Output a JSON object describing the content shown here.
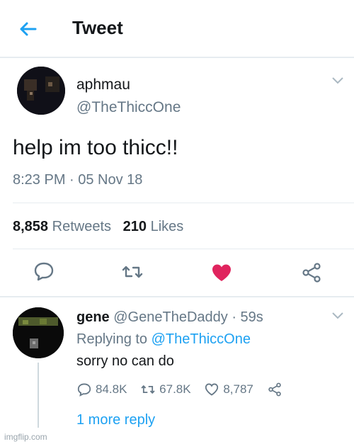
{
  "header": {
    "title": "Tweet"
  },
  "tweet": {
    "name": "aphmau",
    "handle": "@TheThiccOne",
    "text": "help im too thicc!!",
    "timestamp": "8:23 PM · 05 Nov 18",
    "retweets_count": "8,858",
    "retweets_label": "Retweets",
    "likes_count": "210",
    "likes_label": "Likes"
  },
  "reply": {
    "name": "gene",
    "handle": "@GeneTheDaddy",
    "time": "· 59s",
    "replying_prefix": "Replying to",
    "replying_to": "@TheThiccOne",
    "text": "sorry no can do",
    "reply_count": "84.8K",
    "retweet_count": "67.8K",
    "like_count": "8,787",
    "more_replies": "1 more reply"
  },
  "watermark": "imgflip.com",
  "colors": {
    "accent": "#1da1f2",
    "like": "#e0245e",
    "secondary_text": "#657786",
    "primary_text": "#14171a"
  },
  "icons": [
    "back-arrow-icon",
    "chevron-down-icon",
    "comment-icon",
    "retweet-icon",
    "heart-filled-icon",
    "share-icon",
    "heart-outline-icon"
  ]
}
